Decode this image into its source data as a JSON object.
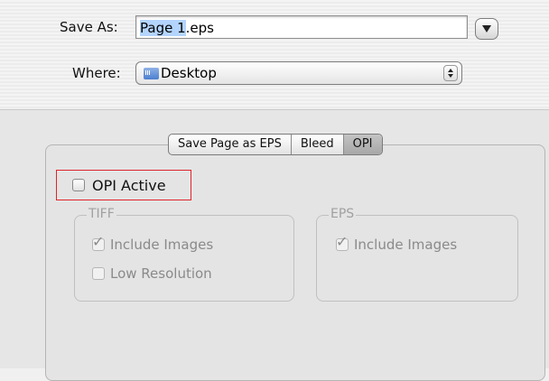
{
  "save_as": {
    "label": "Save As:",
    "value_selected": "Page 1",
    "value_rest": ".eps"
  },
  "where": {
    "label": "Where:",
    "value": "Desktop"
  },
  "tabs": [
    {
      "label": "Save Page as EPS",
      "active": false
    },
    {
      "label": "Bleed",
      "active": false
    },
    {
      "label": "OPI",
      "active": true
    }
  ],
  "opi_active": {
    "label": "OPI Active",
    "checked": false
  },
  "tiff": {
    "title": "TIFF",
    "include_images": {
      "label": "Include Images",
      "checked": true,
      "enabled": false
    },
    "low_resolution": {
      "label": "Low Resolution",
      "checked": false,
      "enabled": false
    }
  },
  "eps": {
    "title": "EPS",
    "include_images": {
      "label": "Include Images",
      "checked": true,
      "enabled": false
    }
  },
  "colors": {
    "highlight": "#e0242b",
    "selection": "#b3d4fd"
  }
}
